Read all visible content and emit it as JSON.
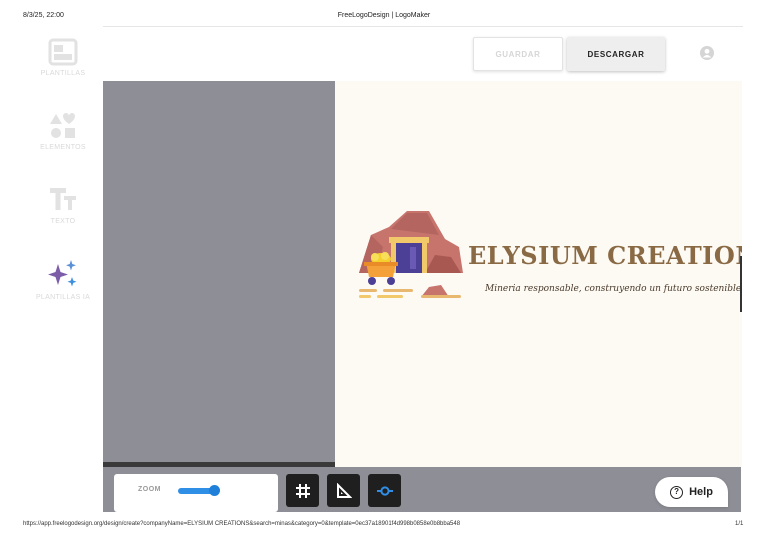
{
  "print": {
    "date": "8/3/25, 22:00",
    "title": "FreeLogoDesign | LogoMaker",
    "url": "https://app.freelogodesign.org/design/create?companyName=ELYSIUM CREATIONS&search=minas&category=0&template=0ec37a18901f4d998b0858e0b8bba548",
    "page": "1/1"
  },
  "sidebar": {
    "items": [
      {
        "label": "PLANTILLAS",
        "icon": "templates-icon"
      },
      {
        "label": "ELEMENTOS",
        "icon": "shapes-icon"
      },
      {
        "label": "TEXTO",
        "icon": "text-icon"
      },
      {
        "label": "PLANTILLAS IA",
        "icon": "ai-sparkle-icon"
      }
    ]
  },
  "toolbar": {
    "save_label": "GUARDAR",
    "download_label": "DESCARGAR",
    "avatar_icon": "user-avatar-icon"
  },
  "artboard": {
    "brand_name": "ELYSIUM CREATIONS",
    "tagline": "Mineria responsable, construyendo un futuro sostenible.",
    "logo_icon": "mine-cart-icon"
  },
  "bottom": {
    "zoom_label": "ZOOM",
    "zoom_level": 0.85,
    "tools": [
      "grid-icon",
      "ruler-icon",
      "guide-line-icon"
    ],
    "help_label": "Help"
  },
  "colors": {
    "canvas_gray": "#8e8e96",
    "brand_title": "#8a6a45",
    "zoom_accent": "#1f7fd9",
    "artboard_bg": "#fdfaf4"
  }
}
